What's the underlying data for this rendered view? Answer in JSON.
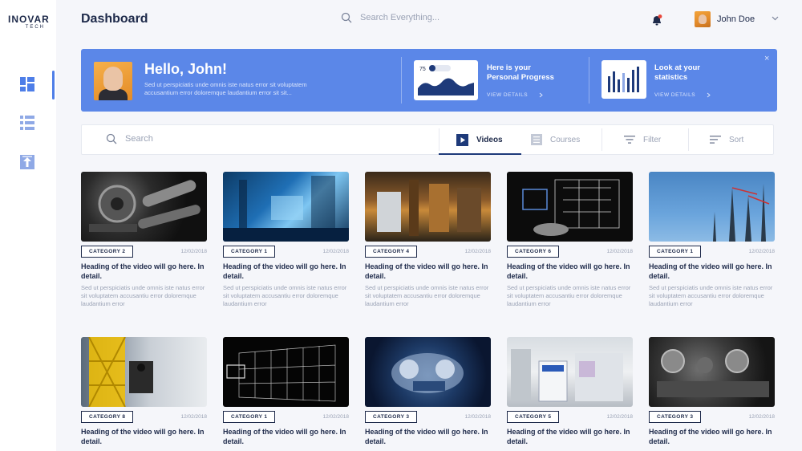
{
  "brand": {
    "name": "INOVAR",
    "sub": "TECH"
  },
  "header": {
    "title": "Dashboard",
    "search_placeholder": "Search Everything...",
    "user_name": "John Doe"
  },
  "sidebar": {
    "items": [
      {
        "icon": "dashboard-grid-icon",
        "active": true
      },
      {
        "icon": "list-icon",
        "active": false
      },
      {
        "icon": "upload-icon",
        "active": false
      }
    ]
  },
  "banner": {
    "greeting": "Hello, John!",
    "subtext": "Sed ut perspiciatis unde omnis iste natus error sit voluptatem accusantium error doloremque laudantium error sit sit...",
    "progress_card": {
      "value": "75",
      "title_line1": "Here is your",
      "title_line2": "Personal Progress",
      "link": "VIEW DETAILS"
    },
    "stats_card": {
      "title_line1": "Look at your",
      "title_line2": "statistics",
      "link": "VIEW DETAILS"
    },
    "close": "×"
  },
  "toolbar": {
    "search_placeholder": "Search",
    "videos": "Videos",
    "courses": "Courses",
    "filter": "Filter",
    "sort": "Sort"
  },
  "videos": [
    {
      "category": "CATEGORY 2",
      "date": "12/02/2018",
      "title": "Heading of the video will go here. In detail.",
      "desc": "Sed ut perspiciatis unde omnis iste natus error sit voluptatem accusantiu error doloremque laudantium error"
    },
    {
      "category": "CATEGORY 1",
      "date": "12/02/2018",
      "title": "Heading of the video will go here. In detail.",
      "desc": "Sed ut perspiciatis unde omnis iste natus error sit voluptatem accusantiu error doloremque laudantium error"
    },
    {
      "category": "CATEGORY 4",
      "date": "12/02/2018",
      "title": "Heading of the video will go here. In detail.",
      "desc": "Sed ut perspiciatis unde omnis iste natus error sit voluptatem accusantiu error doloremque laudantium error"
    },
    {
      "category": "CATEGORY 6",
      "date": "12/02/2018",
      "title": "Heading of the video will go here. In detail.",
      "desc": "Sed ut perspiciatis unde omnis iste natus error sit voluptatem accusantiu error doloremque laudantium error"
    },
    {
      "category": "CATEGORY 1",
      "date": "12/02/2018",
      "title": "Heading of the video will go here. In detail.",
      "desc": "Sed ut perspiciatis unde omnis iste natus error sit voluptatem accusantiu error doloremque laudantium error"
    },
    {
      "category": "CATEGORY 8",
      "date": "12/02/2018",
      "title": "Heading of the video will go here. In detail.",
      "desc": ""
    },
    {
      "category": "CATEGORY 1",
      "date": "12/02/2018",
      "title": "Heading of the video will go here. In detail.",
      "desc": ""
    },
    {
      "category": "CATEGORY 3",
      "date": "12/02/2018",
      "title": "Heading of the video will go here. In detail.",
      "desc": ""
    },
    {
      "category": "CATEGORY 5",
      "date": "12/02/2018",
      "title": "Heading of the video will go here. In detail.",
      "desc": ""
    },
    {
      "category": "CATEGORY 3",
      "date": "12/02/2018",
      "title": "Heading of the video will go here. In detail.",
      "desc": ""
    }
  ],
  "colors": {
    "accent": "#5b87e8",
    "navy": "#1e2a4a",
    "muted": "#9aa2b5",
    "background": "#f5f6fa"
  }
}
